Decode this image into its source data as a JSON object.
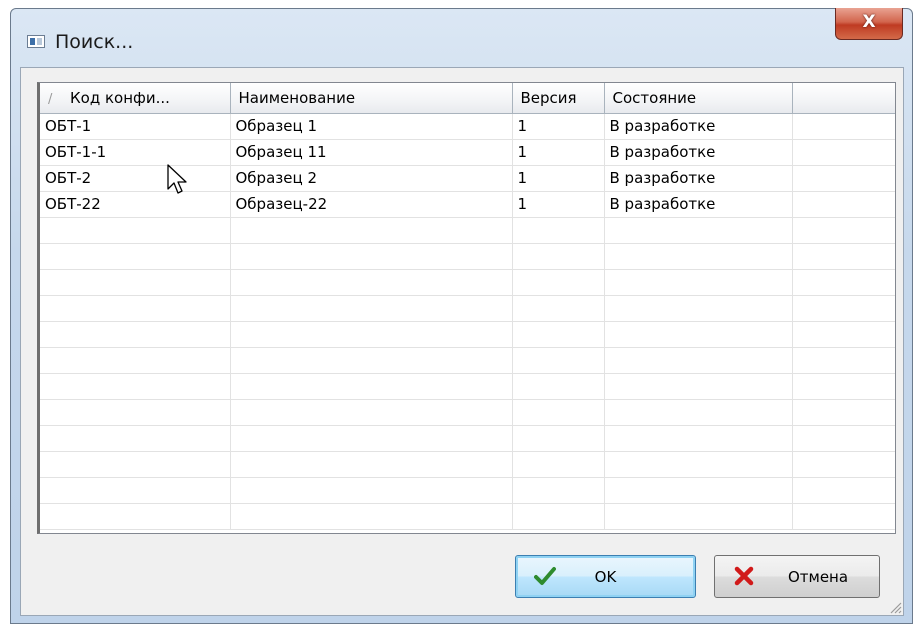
{
  "window": {
    "title": "Поиск...",
    "close_label": "X"
  },
  "table": {
    "columns": [
      "Код конфи...",
      "Наименование",
      "Версия",
      "Состояние",
      ""
    ],
    "sort_indicator": "/",
    "rows": [
      [
        "ОБТ-1",
        "Образец 1",
        "1",
        "В разработке",
        ""
      ],
      [
        "ОБТ-1-1",
        "Образец 11",
        "1",
        "В разработке",
        ""
      ],
      [
        "ОБТ-2",
        "Образец 2",
        "1",
        "В разработке",
        ""
      ],
      [
        "ОБТ-22",
        "Образец-22",
        "1",
        "В разработке",
        ""
      ],
      [
        "",
        "",
        "",
        "",
        ""
      ],
      [
        "",
        "",
        "",
        "",
        ""
      ],
      [
        "",
        "",
        "",
        "",
        ""
      ],
      [
        "",
        "",
        "",
        "",
        ""
      ],
      [
        "",
        "",
        "",
        "",
        ""
      ],
      [
        "",
        "",
        "",
        "",
        ""
      ],
      [
        "",
        "",
        "",
        "",
        ""
      ],
      [
        "",
        "",
        "",
        "",
        ""
      ],
      [
        "",
        "",
        "",
        "",
        ""
      ],
      [
        "",
        "",
        "",
        "",
        ""
      ],
      [
        "",
        "",
        "",
        "",
        ""
      ],
      [
        "",
        "",
        "",
        "",
        ""
      ]
    ]
  },
  "buttons": {
    "ok_label": "OK",
    "ok_icon": "checkmark-icon",
    "cancel_label": "Отмена",
    "cancel_icon": "red-x-icon"
  },
  "colors": {
    "check": "#2e8b2e",
    "cancel_x": "#d11a1a",
    "ok_border": "#3c7fb1"
  }
}
